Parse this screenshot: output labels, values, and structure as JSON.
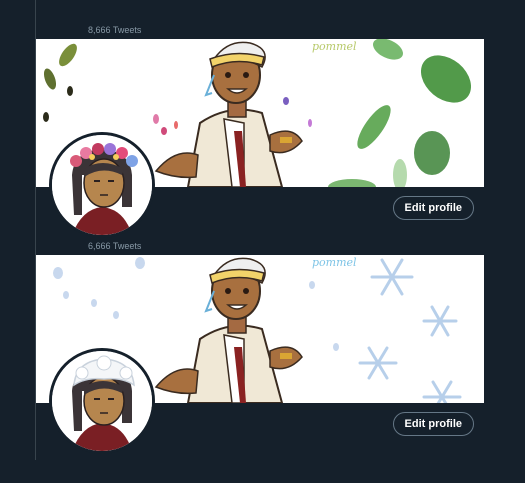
{
  "profiles": [
    {
      "tweets_label": "8,666 Tweets",
      "theme": "leaves",
      "signature": "pommel",
      "edit_label": "Edit profile",
      "accent_color": "#55a84a"
    },
    {
      "tweets_label": "6,666 Tweets",
      "theme": "snowflakes",
      "signature": "pommel",
      "edit_label": "Edit profile",
      "accent_color": "#a9c7e6"
    }
  ],
  "colors": {
    "background": "#15202b",
    "divider": "#38444d",
    "button_border": "#657786",
    "muted_text": "#8899a6"
  }
}
